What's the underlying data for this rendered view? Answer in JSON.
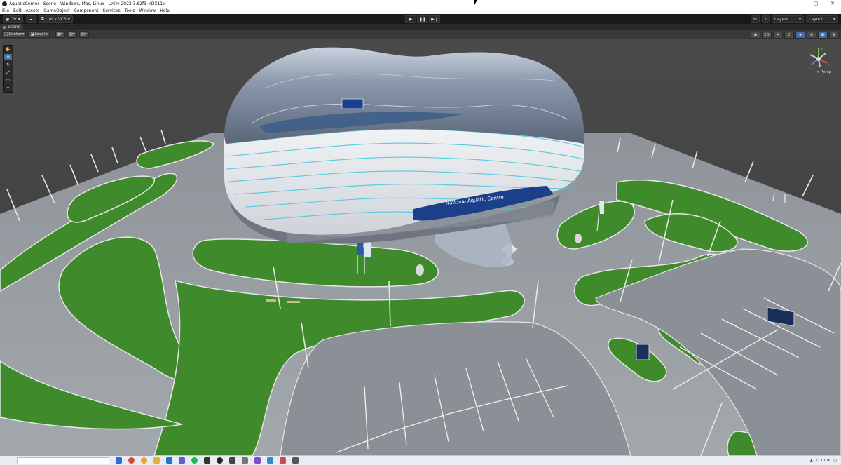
{
  "window": {
    "title": "AquaticCenter - Scene - Windows, Mac, Linux - Unity 2022.3.62f3 <DX11>",
    "controls": [
      "–",
      "▢",
      "✕"
    ]
  },
  "menu": [
    "File",
    "Edit",
    "Assets",
    "GameObject",
    "Component",
    "Services",
    "Tools",
    "Window",
    "Help"
  ],
  "toolbar": {
    "account": "OV",
    "vcs": "Unity VCS",
    "layers": "Layers",
    "layout": "Layout"
  },
  "tabs": {
    "scene": "Scene"
  },
  "scene_toolbar": {
    "pivot": "Center",
    "space": "Local",
    "mode_2d": "2D"
  },
  "viewport": {
    "signage": "National Aquatic Centre",
    "projection": "< Persp",
    "gizmo_axes": {
      "x": "x",
      "y": "y",
      "z": "z"
    }
  },
  "taskbar": {
    "time": "10:16"
  }
}
